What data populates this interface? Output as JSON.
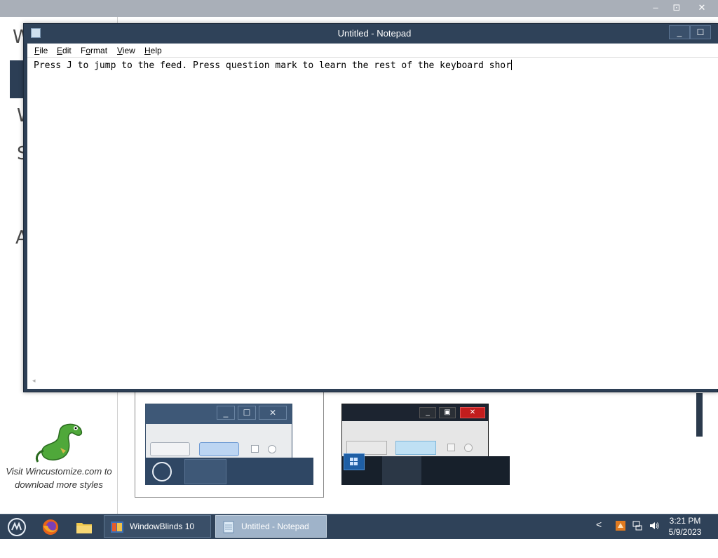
{
  "background_window": {
    "caption_buttons": [
      "–",
      "⊡",
      "✕"
    ],
    "fragments": [
      "W",
      "S",
      "W",
      "S",
      "A"
    ],
    "promo_text": "Visit Wincustomize.com to download more styles"
  },
  "notepad": {
    "title": "Untitled - Notepad",
    "caption_buttons": [
      "_",
      "☐"
    ],
    "menu": [
      "File",
      "Edit",
      "Format",
      "View",
      "Help"
    ],
    "menu_accel": [
      "F",
      "E",
      "o",
      "V",
      "H"
    ],
    "content": "Press J to jump to the feed. Press question mark to learn the rest of the keyboard shor"
  },
  "preview1": {
    "caption_buttons": [
      "_",
      "☐",
      "✕"
    ]
  },
  "preview2": {
    "caption_buttons": [
      "_",
      "▣",
      "✕"
    ]
  },
  "taskbar": {
    "pinned": [
      "windowblinds-start-icon",
      "firefox-icon",
      "file-explorer-icon"
    ],
    "tasks": [
      {
        "label": "WindowBlinds 10 Co...",
        "icon": "windowblinds-app-icon",
        "active": false
      },
      {
        "label": "Untitled - Notepad",
        "icon": "notepad-icon",
        "active": true
      }
    ],
    "tray": {
      "chevron": "<",
      "icons": [
        "stardock-icon",
        "network-icon",
        "volume-icon"
      ]
    },
    "clock": {
      "time": "3:21 PM",
      "date": "5/9/2023"
    }
  },
  "colors": {
    "notepad_frame": "#2f4259",
    "taskbar": "#2f4259",
    "active_task": "#9fb3c9"
  }
}
